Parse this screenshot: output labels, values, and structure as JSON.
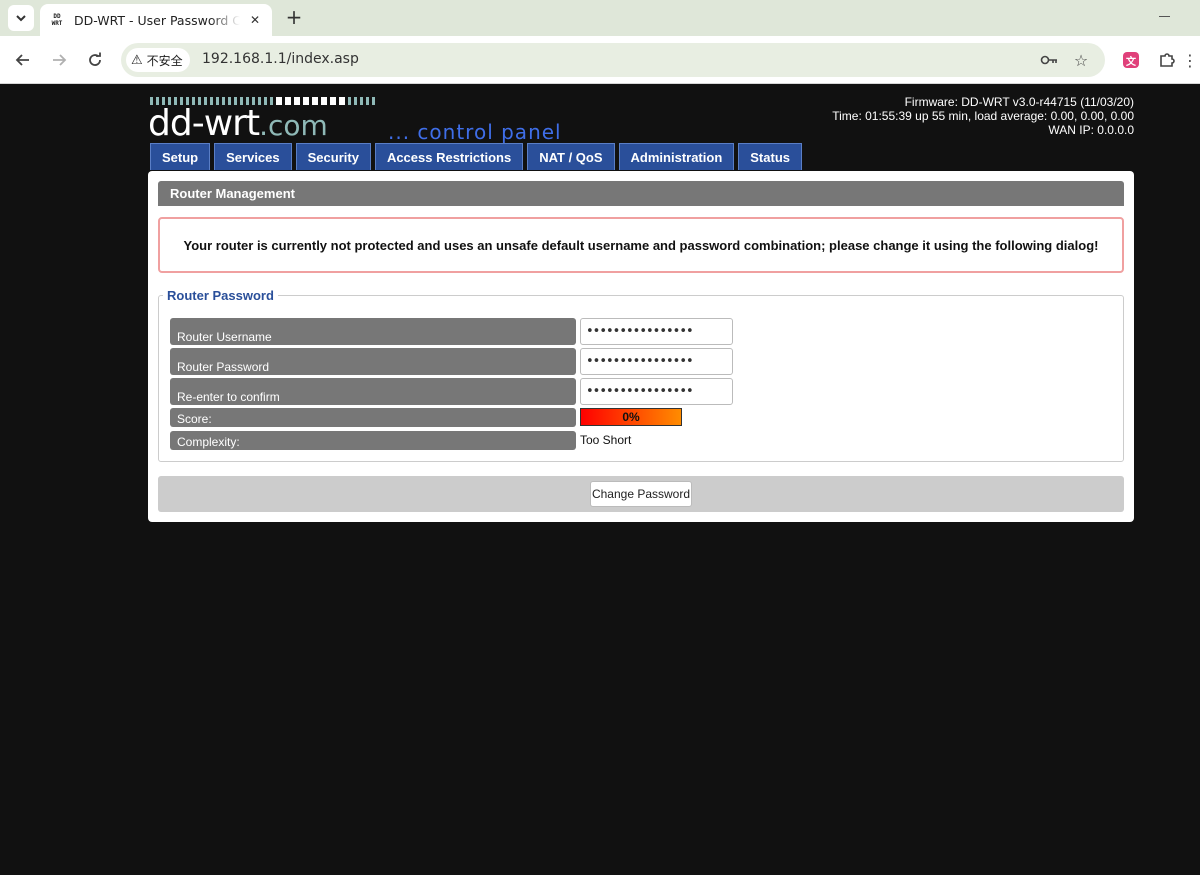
{
  "browser": {
    "tab_title": "DD-WRT - User Password Change",
    "favicon_text": "DD WRT",
    "security_label": "不安全",
    "url": "192.168.1.1/index.asp"
  },
  "header": {
    "logo_main": "dd-wrt",
    "logo_dotcom": ".com",
    "logo_sub": "... control panel",
    "firmware": "Firmware: DD-WRT v3.0-r44715 (11/03/20)",
    "time": "Time: 01:55:39 up 55 min, load average: 0.00, 0.00, 0.00",
    "wan_ip": "WAN IP: 0.0.0.0"
  },
  "menu": {
    "items": [
      {
        "label": "Setup"
      },
      {
        "label": "Services"
      },
      {
        "label": "Security"
      },
      {
        "label": "Access Restrictions"
      },
      {
        "label": "NAT / QoS"
      },
      {
        "label": "Administration"
      },
      {
        "label": "Status"
      }
    ]
  },
  "panel": {
    "title": "Router Management",
    "warning": "Your router is currently not protected and uses an unsafe default username and password combination; please change it using the following dialog!",
    "fieldset_legend": "Router Password",
    "fields": {
      "username_label": "Router Username",
      "username_value": "••••••••••••••••",
      "password_label": "Router Password",
      "password_value": "••••••••••••••••",
      "confirm_label": "Re-enter to confirm",
      "confirm_value": "••••••••••••••••",
      "score_label": "Score:",
      "score_value": "0%",
      "score_fraction": 0,
      "complexity_label": "Complexity:",
      "complexity_value": "Too Short"
    },
    "submit_label": "Change Password"
  },
  "colors": {
    "menu_bg": "#2a4f9a",
    "header_bg": "#777777",
    "warning_border": "#f0a0a0",
    "logo_accent": "#8fb9b7",
    "logo_sub": "#3f6ee8"
  }
}
